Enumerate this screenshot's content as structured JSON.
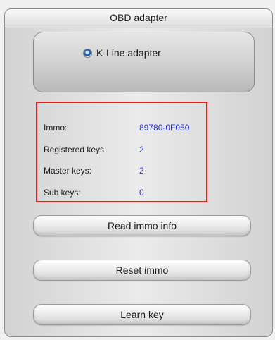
{
  "panel": {
    "title": "OBD adapter"
  },
  "adapter": {
    "selected_label": "K-Line adapter",
    "selected": true
  },
  "immo_info": {
    "rows": [
      {
        "label": "Immo:",
        "value": "89780-0F050"
      },
      {
        "label": "Registered keys:",
        "value": "2"
      },
      {
        "label": "Master keys:",
        "value": "2"
      },
      {
        "label": "Sub keys:",
        "value": "0"
      }
    ]
  },
  "buttons": {
    "read_immo_info": "Read immo info",
    "reset_immo": "Reset immo",
    "learn_key": "Learn key"
  },
  "colors": {
    "highlight_border": "#e32018",
    "value_text": "#2030e0",
    "radio_dot": "#2a6fc4"
  }
}
